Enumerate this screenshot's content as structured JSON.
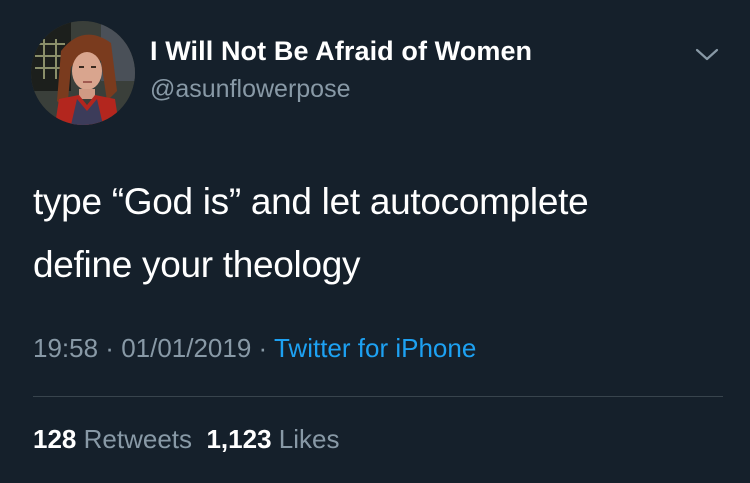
{
  "tweet": {
    "display_name": "I Will Not Be Afraid of Women",
    "handle": "@asunflowerpose",
    "text_line1": "type “God is” and let autocomplete",
    "text_line2": "define your theology",
    "time": "19:58",
    "separator1": " · ",
    "date": "01/01/2019",
    "separator2": " · ",
    "source": "Twitter for iPhone",
    "retweets_count": "128",
    "retweets_label": "Retweets",
    "likes_count": "1,123",
    "likes_label": "Likes"
  },
  "icons": {
    "menu": "chevron-down-icon",
    "avatar": "profile-photo"
  },
  "colors": {
    "background": "#15202b",
    "primary_text": "#ffffff",
    "secondary_text": "#8899a6",
    "link": "#1da1f2",
    "divider": "#38444d"
  }
}
